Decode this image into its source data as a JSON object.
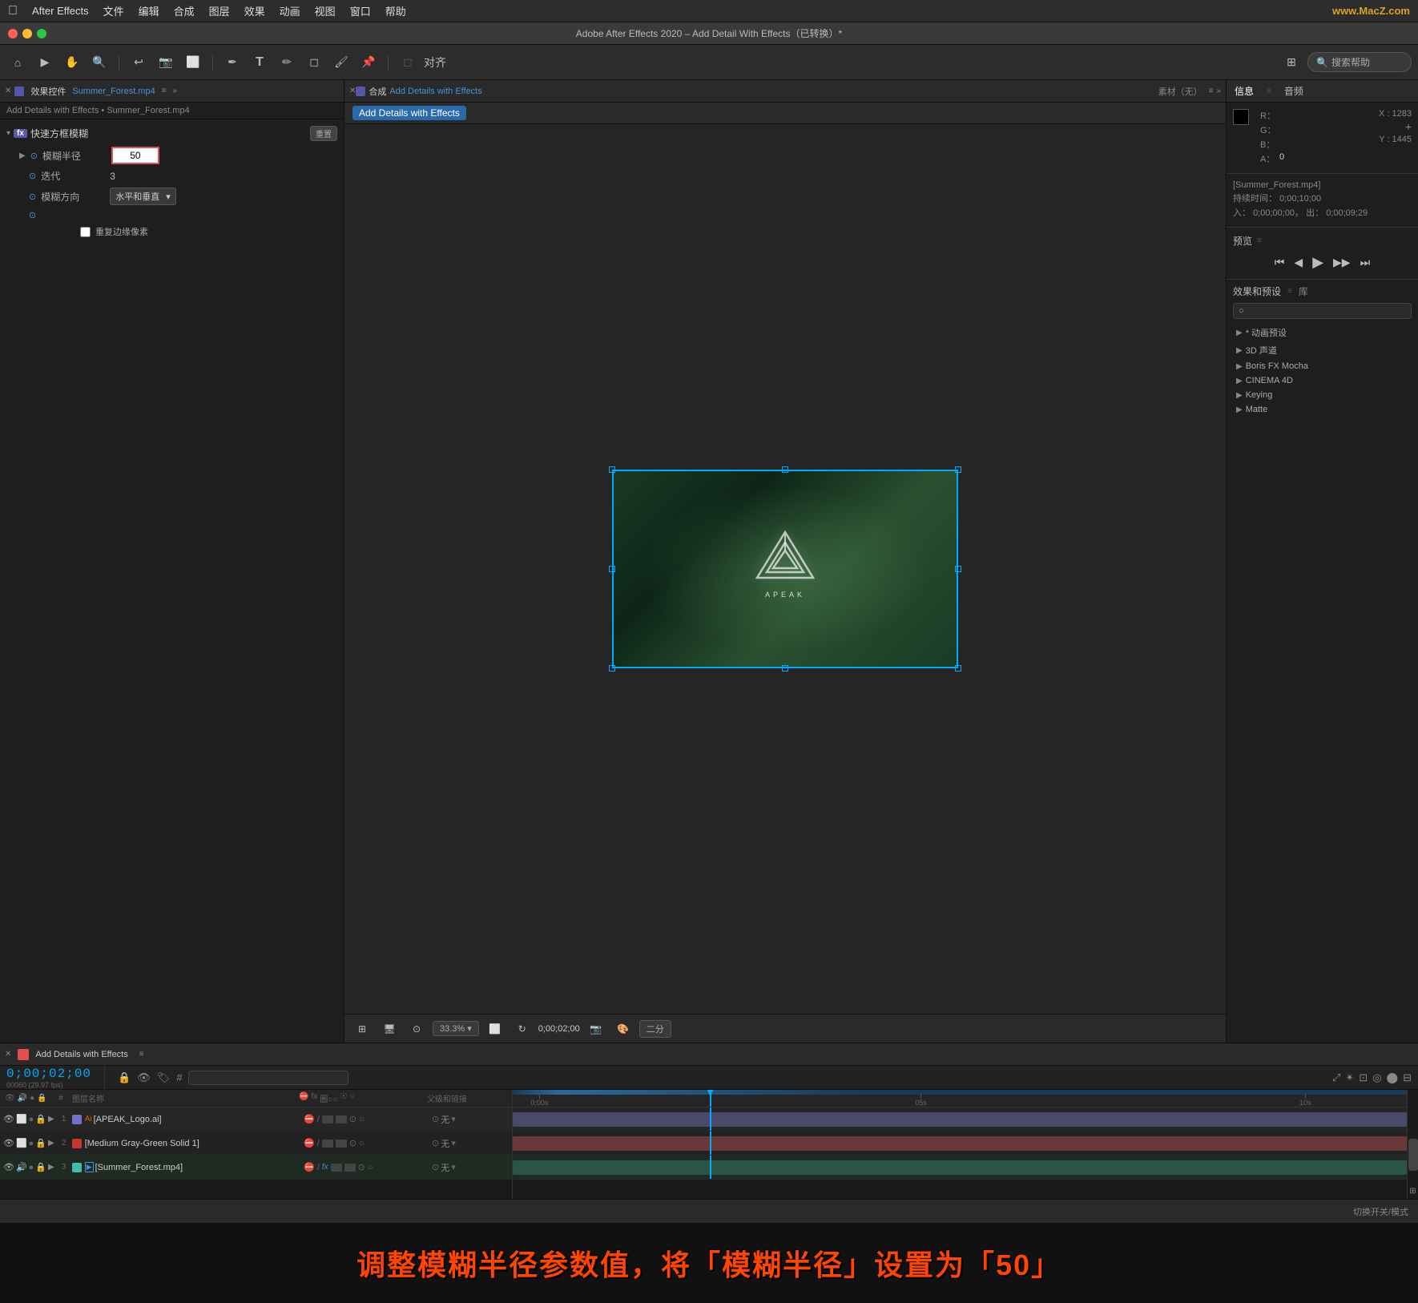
{
  "menubar": {
    "apple": "&#63743;",
    "items": [
      "After Effects",
      "文件",
      "编辑",
      "合成",
      "图层",
      "效果",
      "动画",
      "视图",
      "窗口",
      "帮助"
    ],
    "watermark": "www.MacZ.com"
  },
  "titlebar": {
    "title": "Adobe After Effects 2020 – Add Detail With Effects（已转换）*"
  },
  "toolbar": {
    "search_placeholder": "搜索帮助"
  },
  "effects_panel": {
    "tab_label": "效果控件",
    "file_label": "Summer_Forest.mp4",
    "breadcrumb": "Add Details with Effects • Summer_Forest.mp4",
    "fx_label": "fx",
    "section_name": "快速方框模糊",
    "reset_label": "重置",
    "blur_radius_label": "模糊半径",
    "blur_radius_value": "50",
    "iterations_label": "迭代",
    "iterations_value": "3",
    "blur_dir_label": "模糊方向",
    "blur_dir_value": "水平和垂直",
    "repeat_edge_label": "重复边缘像素"
  },
  "composition_panel": {
    "tab_label": "合成",
    "comp_name": "Add Details with Effects",
    "material_label": "素材（无）",
    "view_label": "Add Details with Effects",
    "zoom_label": "33.3%",
    "timecode": "0;00;02;00",
    "quality_label": "二分"
  },
  "info_panel": {
    "tab_info": "信息",
    "tab_audio": "音频",
    "r_label": "R：",
    "r_value": "",
    "g_label": "G：",
    "g_value": "",
    "b_label": "B：",
    "b_value": "",
    "a_label": "A：",
    "a_value": "0",
    "x_label": "X",
    "x_value": "1283",
    "y_label": "Y",
    "y_value": "1445",
    "file_name": "[Summer_Forest.mp4]",
    "duration_label": "持续时间：",
    "duration_value": "0;00;10;00",
    "in_label": "入：",
    "in_value": "0;00;00;00，",
    "out_label": "出：",
    "out_value": "0;00;09;29",
    "preview_title": "预览",
    "effects_title": "效果和预设",
    "library_label": "库",
    "search_placeholder": "搜索...",
    "effects_items": [
      {
        "label": "* 动画预设",
        "expandable": true
      },
      {
        "label": "3D 声道",
        "expandable": true
      },
      {
        "label": "Boris FX Mocha",
        "expandable": true
      },
      {
        "label": "CINEMA 4D",
        "expandable": true
      },
      {
        "label": "Keying",
        "expandable": true
      },
      {
        "label": "Matte",
        "expandable": true
      }
    ]
  },
  "timeline": {
    "tab_label": "Add Details with Effects",
    "timecode": "0;00;02;00",
    "frame_info": "00060 (29.97 fps)",
    "layers": [
      {
        "num": "1",
        "color": "#7070cc",
        "name": "[APEAK_Logo.ai]",
        "has_ai_icon": true,
        "parent": "无"
      },
      {
        "num": "2",
        "color": "#cc3333",
        "name": "[Medium Gray-Green Solid 1]",
        "has_solid_icon": true,
        "parent": "无"
      },
      {
        "num": "3",
        "color": "#44bbaa",
        "name": "[Summer_Forest.mp4]",
        "has_video_icon": true,
        "parent": "无",
        "has_fx": true
      }
    ],
    "ruler_marks": [
      {
        "time": "0;00s",
        "pos": 2
      },
      {
        "time": "05s",
        "pos": 45
      },
      {
        "time": "10s",
        "pos": 88
      }
    ]
  },
  "statusbar": {
    "label": "切换开关/模式"
  },
  "annotation": {
    "text": "调整模糊半径参数值，将「模糊半径」设置为「50」"
  },
  "icons": {
    "home": "⌂",
    "arrow": "▶",
    "hand": "✋",
    "search": "🔍",
    "rotate_left": "↩",
    "rotate_right": "↪",
    "box": "⬜",
    "pen": "✒",
    "text": "T",
    "brush": "🖌",
    "eraser": "◻",
    "pin": "📌",
    "play": "▶",
    "pause": "⏸",
    "rewind": "⏮",
    "ff": "⏭",
    "step_back": "◀◀",
    "step_fwd": "▶▶",
    "eye": "👁",
    "lock": "🔒",
    "search_small": "○"
  }
}
